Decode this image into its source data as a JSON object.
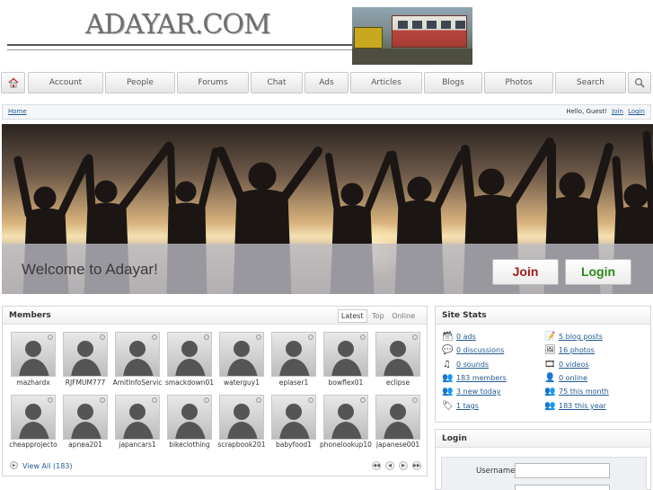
{
  "site": {
    "logo_text": "ADAYAR.COM"
  },
  "nav": {
    "home_icon": "home-icon",
    "tabs": [
      "Account",
      "People",
      "Forums",
      "Chat",
      "Ads",
      "Articles",
      "Blogs",
      "Photos",
      "Search"
    ],
    "search_icon": "magnifier-icon"
  },
  "breadcrumb": {
    "home": "Home",
    "greeting": "Hello, Guest!",
    "join": "Join",
    "login": "Login"
  },
  "hero": {
    "title": "Welcome to Adayar!",
    "join_label": "Join",
    "login_label": "Login"
  },
  "members": {
    "title": "Members",
    "tabs": [
      "Latest",
      "Top",
      "Online"
    ],
    "active_tab": "Latest",
    "users": [
      "mazhardx",
      "RJFMUM777",
      "AmitInfoServic",
      "smackdown01",
      "waterguy1",
      "eplaser1",
      "bowflex01",
      "eclipse",
      "cheapprojecto",
      "apnea201",
      "japancars1",
      "bikeclothing",
      "scrapbook201",
      "babyfood1",
      "phonelookup10",
      "japanese001"
    ],
    "view_all": "View All (183)"
  },
  "stats": {
    "title": "Site Stats",
    "left": [
      "0 ads",
      "0 discussions",
      "0 sounds",
      "183 members",
      "3 new today",
      "1 tags"
    ],
    "right": [
      "5 blog posts",
      "16 photos",
      "0 videos",
      "0 online",
      "75 this month",
      "183 this year"
    ],
    "left_icons": [
      "ads-icon",
      "discussions-icon",
      "sounds-icon",
      "members-icon",
      "new-members-icon",
      "tags-icon"
    ],
    "right_icons": [
      "blog-icon",
      "photos-icon",
      "videos-icon",
      "online-icon",
      "month-icon",
      "year-icon"
    ]
  },
  "login": {
    "title": "Login",
    "username_label": "Username:"
  },
  "colors": {
    "link": "#225b96",
    "join": "#a51b1b",
    "login": "#2a8a18",
    "tab_text": "#555555"
  }
}
